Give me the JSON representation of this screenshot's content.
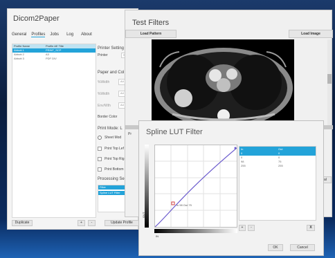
{
  "main_window": {
    "title": "Dicom2Paper",
    "menu": [
      "General",
      "Profiles",
      "Jobs",
      "Log",
      "About"
    ],
    "table_headers": [
      "Profile Name",
      "Profile AE Title"
    ],
    "profiles": [
      {
        "name": "Abbott 1",
        "ae": "PRINT_SCP",
        "selected": true
      },
      {
        "name": "Abbott 2",
        "ae": "A3",
        "selected": false
      },
      {
        "name": "Abbott 3",
        "ae": "PDF DIV",
        "selected": false
      }
    ],
    "printer_settings_label": "Printer Setting",
    "printer_label": "Printer",
    "printer_value": "S",
    "paper_label": "Paper and Col",
    "paper_fields": [
      {
        "label": "%Width",
        "value": "A4"
      },
      {
        "label": "%Width",
        "value": "A4"
      },
      {
        "label": "Env/Wth",
        "value": "A4"
      }
    ],
    "border_color_label": "Border Color",
    "print_mode_label": "Print Mode: L",
    "sheet_mode_label": "Sheet Mod",
    "print_options": [
      "Print Top Lef",
      "Print Top Rig",
      "Print Bottom"
    ],
    "processing_label": "Processing Se",
    "processing_header": "Filter",
    "processing_item": "Spline LUT Filter",
    "duplicate_label": "Duplicate",
    "update_profile_label": "Update Profile",
    "add_symbol": "+",
    "remove_symbol": "-"
  },
  "test_filters": {
    "title": "Test Filters",
    "load_pattern_label": "Load Pattern",
    "load_image_label": "Load Image",
    "close_symbol": "×",
    "partial_label": "Pr",
    "side_button": "al"
  },
  "spline_dialog": {
    "title": "Spline LUT Filter",
    "axis_out": "OUT",
    "axis_in": "IN",
    "point_label": "in 98 Out 75",
    "table_headers": [
      "In",
      "Out"
    ],
    "table_rows": [
      {
        "in": "0",
        "out": "0"
      },
      {
        "in": "0",
        "out": "0"
      },
      {
        "in": "98",
        "out": "75"
      },
      {
        "in": "255",
        "out": "255"
      }
    ],
    "add_symbol": "+",
    "remove_symbol": "-",
    "close_table_symbol": "X",
    "ok_label": "OK",
    "cancel_label": "Cancel",
    "accent_color": "#23a3d9",
    "curve_color": "#6a5acd"
  }
}
